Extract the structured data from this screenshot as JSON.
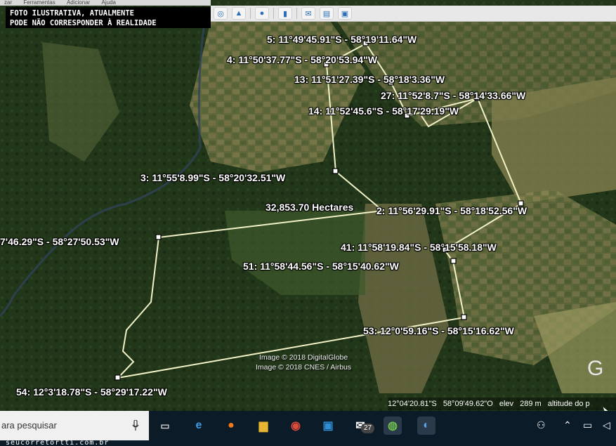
{
  "menubar": {
    "items": [
      "zar",
      "Ferramentas",
      "Adicionar",
      "Ajuda"
    ]
  },
  "toolbar": {
    "icons": [
      "globe-icon",
      "landscape-icon",
      "planet-icon",
      "ruler-icon",
      "email-icon",
      "print-icon",
      "image-icon"
    ]
  },
  "watermark": {
    "line1": "FOTO ILUSTRATIVA, ATUALMENTE",
    "line2": "PODE NÃO CORRESPONDER À REALIDADE"
  },
  "labels": {
    "p5": "5: 11°49'45.91\"S - 58°19'11.64\"W",
    "p4": "4: 11°50'37.77\"S - 58°20'53.94\"W",
    "p13": "13: 11°51'27.39\"S - 58°18'3.36\"W",
    "p27": "27: 11°52'8.7\"S - 58°14'33.66\"W",
    "p14": "14: 11°52'45.6\"S - 58°17'29.19\"W",
    "p3": "3: 11°55'8.99\"S - 58°20'32.51\"W",
    "area": "32,853.70 Hectares",
    "p2": "2: 11°56'29.91\"S - 58°18'52.56\"W",
    "p1": "7'46.29\"S - 58°27'50.53\"W",
    "p41": "41: 11°58'19.84\"S - 58°15'58.18\"W",
    "p51": "51: 11°58'44.56\"S - 58°15'40.62\"W",
    "p53": "53: 12°0'59.16\"S - 58°15'16.62\"W",
    "p54": "54: 12°3'18.78\"S - 58°29'17.22\"W"
  },
  "credits": {
    "c1": "Image © 2018 DigitalGlobe",
    "c2": "Image © 2018 CNES / Airbus"
  },
  "status": {
    "lat": "12°04'20.81\"S",
    "lon": "58°09'49.62\"O",
    "elev_label": "elev",
    "elev": "289 m",
    "alt": "altitude do p"
  },
  "logo": "G",
  "taskbar": {
    "search": "ara pesquisar",
    "mail_badge": "27"
  },
  "site": "seucorretortti.com.br",
  "colors": {
    "forest": "#1f3214",
    "field": "#7a7a48",
    "boundary": "#f2f2c8",
    "taskbar": "#0c1b28"
  }
}
